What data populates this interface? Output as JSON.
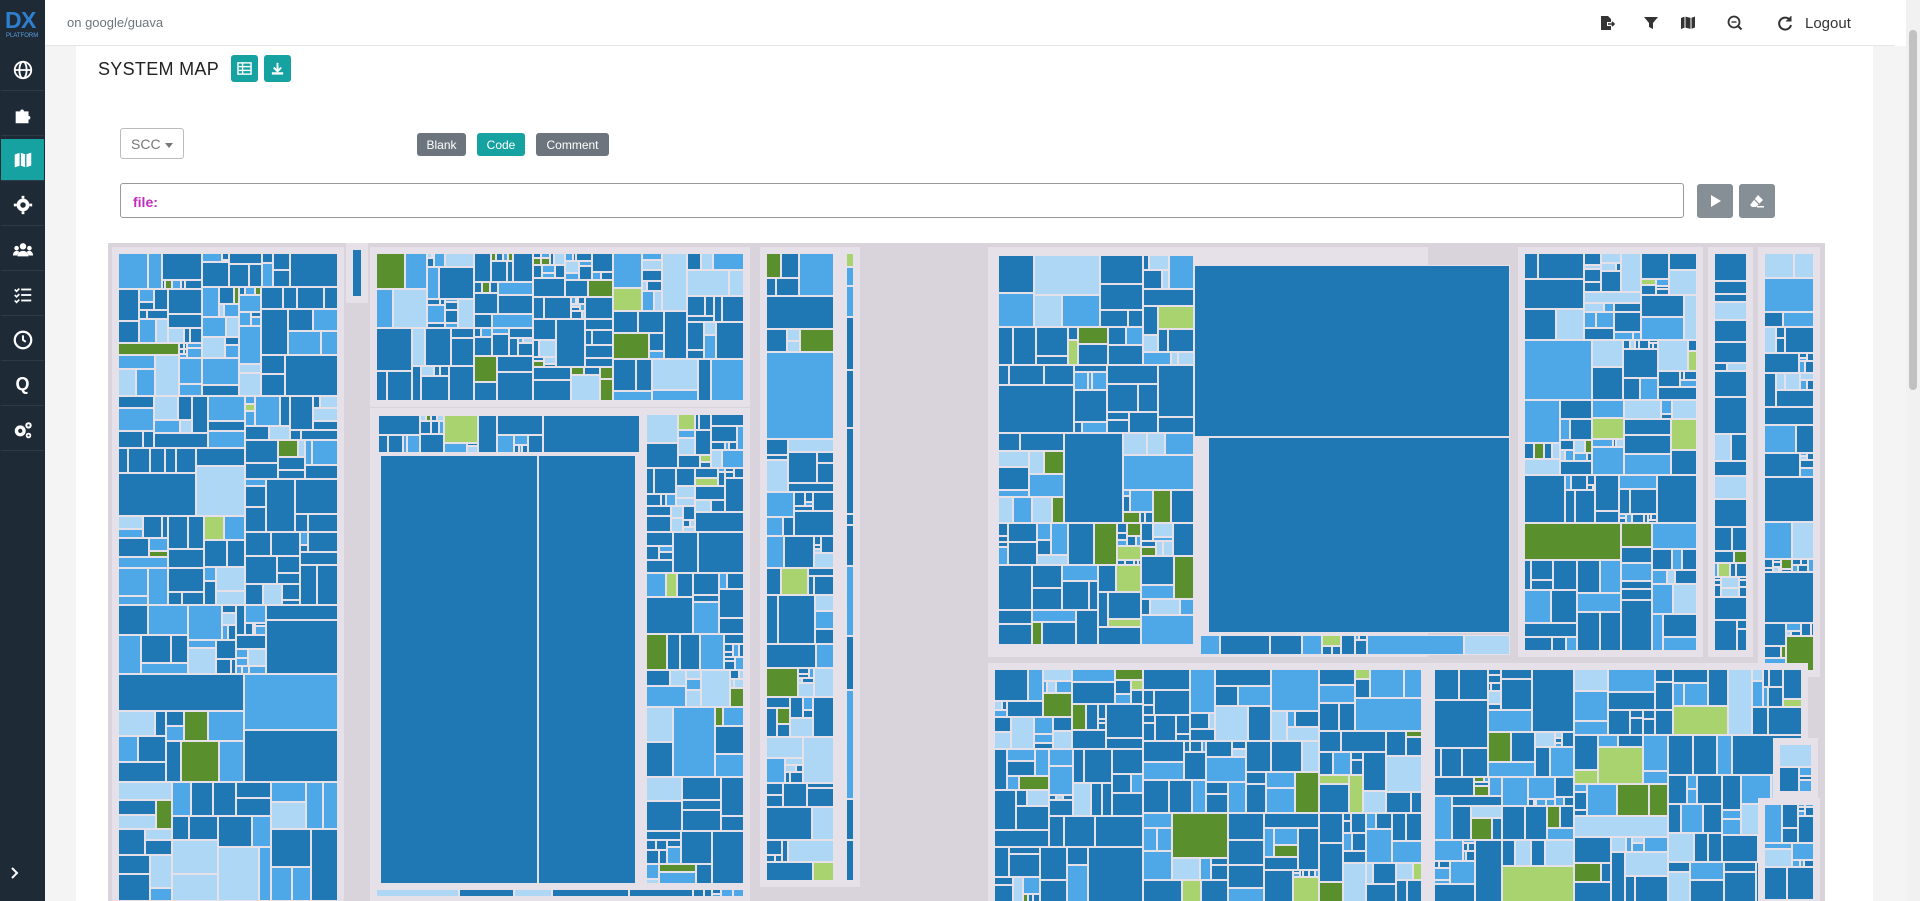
{
  "app": {
    "logo_text": "DX",
    "logo_sub": "PLATFORM",
    "context": "on google/guava"
  },
  "sidebar": {
    "items": [
      {
        "name": "globe-icon",
        "active": false
      },
      {
        "name": "puzzle-icon",
        "active": false
      },
      {
        "name": "map-icon",
        "active": true
      },
      {
        "name": "cog-icon",
        "active": false
      },
      {
        "name": "users-icon",
        "active": false
      },
      {
        "name": "checklist-icon",
        "active": false
      },
      {
        "name": "clock-icon",
        "active": false
      },
      {
        "name": "q-icon",
        "active": false
      },
      {
        "name": "settings-cogs-icon",
        "active": false
      }
    ],
    "q_label": "Q"
  },
  "topbar": {
    "logout_label": "Logout"
  },
  "page": {
    "title": "SYSTEM MAP"
  },
  "controls": {
    "metric_select": "SCC",
    "toggles": [
      "Blank",
      "Code",
      "Comment"
    ],
    "active_toggle": "Code",
    "query_prefix": "file:"
  },
  "colors": {
    "accent": "#17a2a2",
    "sidebar_bg": "#1f2a37",
    "cell_dark": "#1f77b4",
    "cell_mid": "#4ea8e8",
    "cell_light": "#aed6f5",
    "cell_green": "#5a8f2e",
    "cell_lightgreen": "#a9d36e"
  }
}
